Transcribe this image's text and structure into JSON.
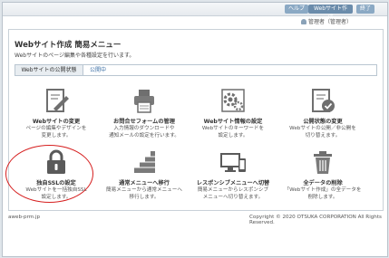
{
  "header": {
    "help_label": "ヘルプ",
    "web_label": "Webサイト作成",
    "close_label": "終了",
    "user_label": "管理者（管理者）"
  },
  "page": {
    "title": "Webサイト作成 簡易メニュー",
    "description": "Webサイトのページ編集や各種設定を行います。"
  },
  "status": {
    "label": "Webサイトの公開状態",
    "value": "公開中"
  },
  "tiles": [
    {
      "title": "Webサイトの変更",
      "line1": "ページの編集やデザインを",
      "line2": "変更します。",
      "icon": "edit-page-icon"
    },
    {
      "title": "お問合せフォームの管理",
      "line1": "入力情報のダウンロードや",
      "line2": "通知メールの設定を行います。",
      "icon": "inquiry-form-icon"
    },
    {
      "title": "Webサイト情報の設定",
      "line1": "Webサイトのキーワードを",
      "line2": "設定します。",
      "icon": "site-settings-gear-icon"
    },
    {
      "title": "公開状態の変更",
      "line1": "Webサイトの公開／非公開を",
      "line2": "切り替えます。",
      "icon": "publish-status-icon"
    },
    {
      "title": "独自SSLの設定",
      "line1": "Webサイトを一括独自SSL",
      "line2": "設定します。",
      "icon": "ssl-lock-icon"
    },
    {
      "title": "通常メニューへ移行",
      "line1": "簡易メニューから通常メニューへ",
      "line2": "移行します。",
      "icon": "stairs-icon"
    },
    {
      "title": "レスポンシブメニューへ切替",
      "line1": "簡易メニューからレスポンシブ",
      "line2": "メニューへ切り替えます。",
      "icon": "responsive-devices-icon"
    },
    {
      "title": "全データの削除",
      "line1": "「Webサイト作成」の全データを",
      "line2": "削除します。",
      "icon": "trash-icon"
    }
  ],
  "footer": {
    "left": "aweb-prm.jp",
    "right": "Copyright © 2020 OTSUKA CORPORATION All Rights Reserved."
  },
  "colors": {
    "accent": "#6b8cab",
    "highlight": "#d61f1f",
    "icon": "#6f6f6f"
  }
}
